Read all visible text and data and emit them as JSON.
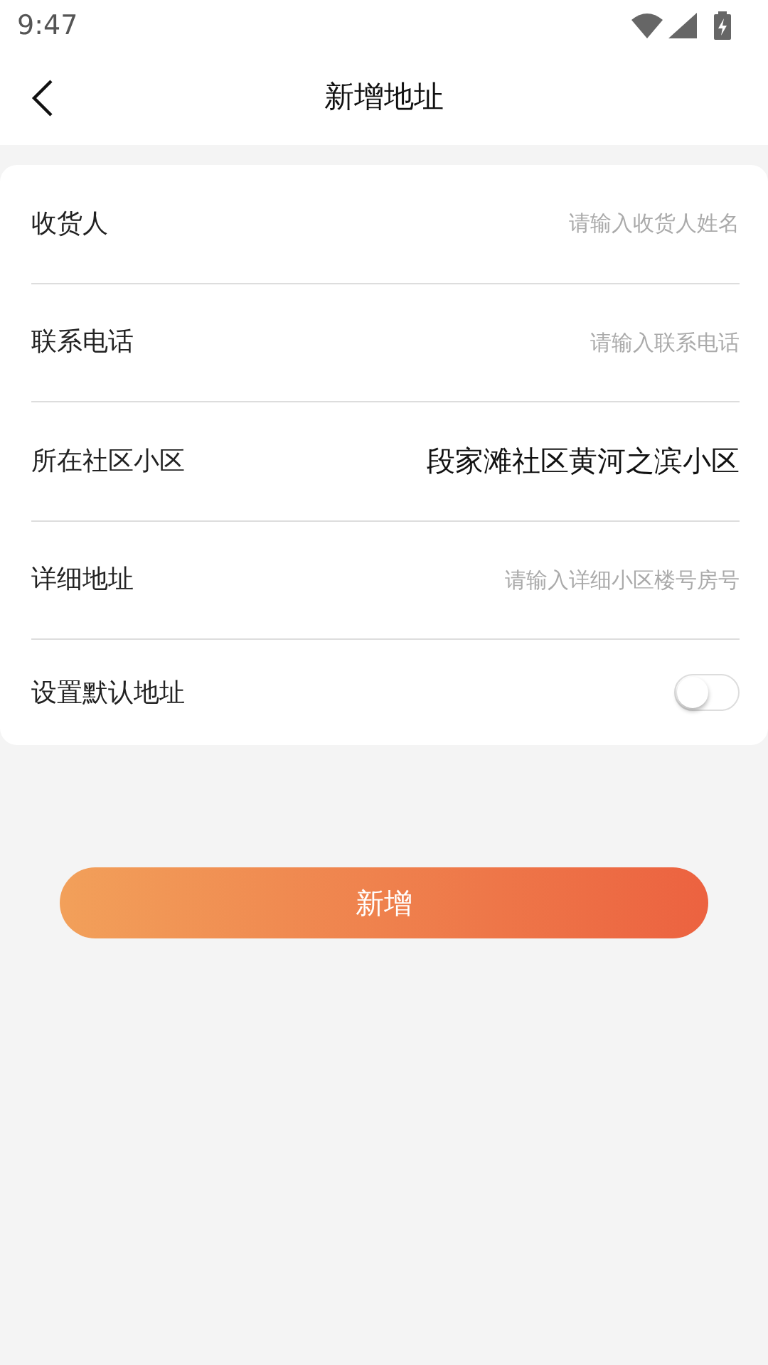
{
  "status_bar": {
    "time": "9:47"
  },
  "header": {
    "title": "新增地址"
  },
  "fields": [
    {
      "kind": "input",
      "label": "收货人",
      "placeholder": "请输入收货人姓名"
    },
    {
      "kind": "input",
      "label": "联系电话",
      "placeholder": "请输入联系电话"
    },
    {
      "kind": "value",
      "label": "所在社区小区",
      "value": "段家滩社区黄河之滨小区"
    },
    {
      "kind": "input",
      "label": "详细地址",
      "placeholder": "请输入详细小区楼号房号"
    },
    {
      "kind": "switch",
      "label": "设置默认地址",
      "on": false
    }
  ],
  "submit": {
    "label": "新增"
  }
}
